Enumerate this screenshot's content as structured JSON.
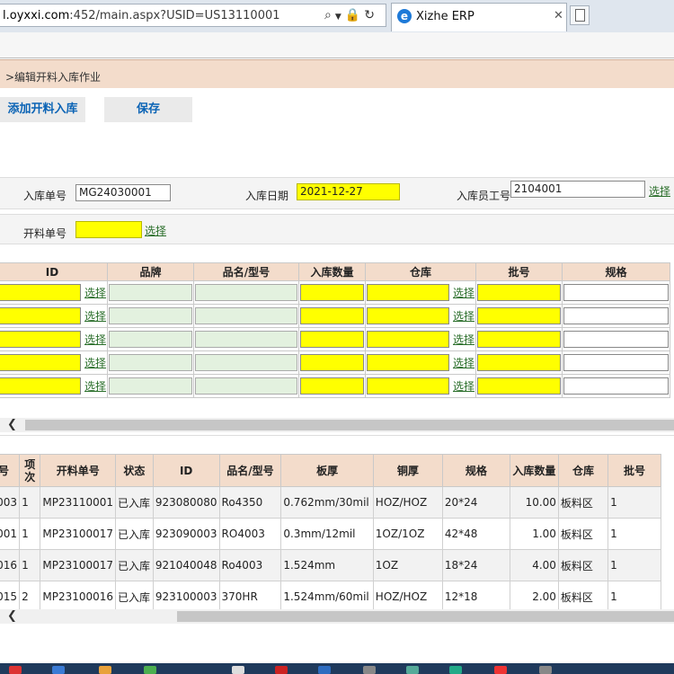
{
  "browser": {
    "address_host": "l.oyxxi.com",
    "address_rest": ":452/main.aspx?USID=US13110001",
    "tab_title": "Xizhe ERP"
  },
  "breadcrumb": ">编辑开料入库作业",
  "toolbar": {
    "add_label": "添加开料入库",
    "save_label": "保存"
  },
  "form": {
    "receipt_no_label": "入库单号",
    "receipt_no": "MG24030001",
    "receipt_date_label": "入库日期",
    "receipt_date": "2021-12-27",
    "employee_label": "入库员工号",
    "employee_no": "2104001",
    "cutting_no_label": "开料单号",
    "cutting_no": "",
    "select_label": "选择"
  },
  "grid": {
    "headers": [
      "ID",
      "品牌",
      "品名/型号",
      "入库数量",
      "仓库",
      "批号",
      "规格"
    ],
    "rows": 5
  },
  "records": {
    "headers": [
      "号",
      "项次",
      "开料单号",
      "状态",
      "ID",
      "品名/型号",
      "板厚",
      "铜厚",
      "规格",
      "入库数量",
      "仓库",
      "批号"
    ],
    "rows": [
      [
        "003",
        "1",
        "MP23110001",
        "已入库",
        "923080080",
        "Ro4350",
        "0.762mm/30mil",
        "HOZ/HOZ",
        "20*24",
        "10.00",
        "板料区",
        "1"
      ],
      [
        "001",
        "1",
        "MP23100017",
        "已入库",
        "923090003",
        "RO4003",
        "0.3mm/12mil",
        "1OZ/1OZ",
        "42*48",
        "1.00",
        "板料区",
        "1"
      ],
      [
        "016",
        "1",
        "MP23100017",
        "已入库",
        "921040048",
        "Ro4003",
        "1.524mm",
        "1OZ",
        "18*24",
        "4.00",
        "板料区",
        "1"
      ],
      [
        "015",
        "2",
        "MP23100016",
        "已入库",
        "923100003",
        "370HR",
        "1.524mm/60mil",
        "HOZ/HOZ",
        "12*18",
        "2.00",
        "板料区",
        "1"
      ]
    ]
  }
}
